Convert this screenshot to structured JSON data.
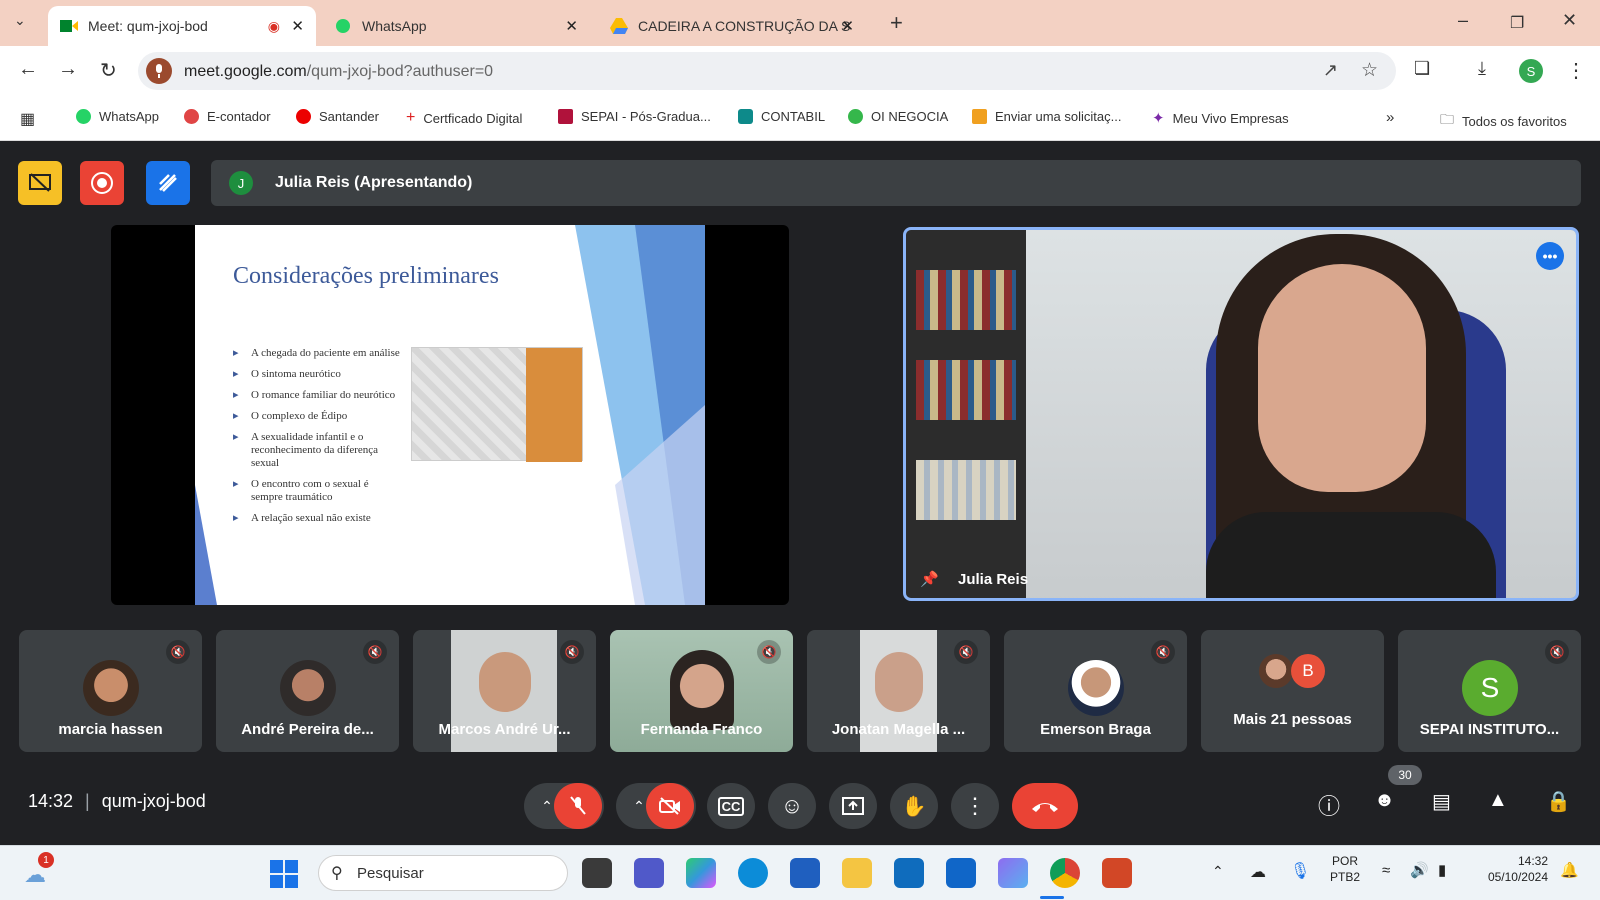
{
  "browser": {
    "tabs": [
      {
        "title": "Meet: qum-jxoj-bod",
        "active": true
      },
      {
        "title": "WhatsApp",
        "active": false
      },
      {
        "title": "CADEIRA A CONSTRUÇÃO DA S",
        "active": false
      }
    ],
    "url_host": "meet.google.com",
    "url_path": "/qum-jxoj-bod?authuser=0",
    "profile_initial": "S",
    "bookmarks": [
      "WhatsApp",
      "E-contador",
      "Santander",
      "Certficado Digital",
      "SEPAI - Pós-Gradua...",
      "CONTABIL",
      "OI NEGOCIA",
      "Enviar uma solicitaç...",
      "Meu Vivo Empresas"
    ],
    "all_bookmarks": "Todos os favoritos"
  },
  "meet": {
    "presenter_initial": "J",
    "presenter_label": "Julia Reis (Apresentando)",
    "slide": {
      "title": "Considerações preliminares",
      "bullets": [
        "A chegada do paciente em análise",
        "O sintoma neurótico",
        "O romance familiar do neurótico",
        "O complexo de Édipo",
        "A sexualidade infantil e o reconhecimento da diferença sexual",
        "O encontro com o sexual é sempre traumático",
        "A relação sexual não existe"
      ]
    },
    "speaker_name": "Julia Reis",
    "participants": [
      {
        "name": "marcia hassen"
      },
      {
        "name": "André Pereira de..."
      },
      {
        "name": "Marcos André Ur..."
      },
      {
        "name": "Fernanda Franco"
      },
      {
        "name": "Jonatan Magella ..."
      },
      {
        "name": "Emerson Braga"
      },
      {
        "name": "Mais 21 pessoas",
        "avatar_initial": "B"
      },
      {
        "name": "SEPAI INSTITUTO...",
        "avatar_initial": "S"
      }
    ],
    "time": "14:32",
    "meeting_code": "qum-jxoj-bod",
    "participant_count": "30"
  },
  "taskbar": {
    "notification_count": "1",
    "search_placeholder": "Pesquisar",
    "lang_top": "POR",
    "lang_bottom": "PTB2",
    "clock_time": "14:32",
    "clock_date": "05/10/2024"
  },
  "colors": {
    "meet_bg": "#202124",
    "tile_bg": "#3c4043",
    "end_call": "#ea4335",
    "accent": "#1a73e8",
    "tab_strip": "#f3d1c3"
  }
}
